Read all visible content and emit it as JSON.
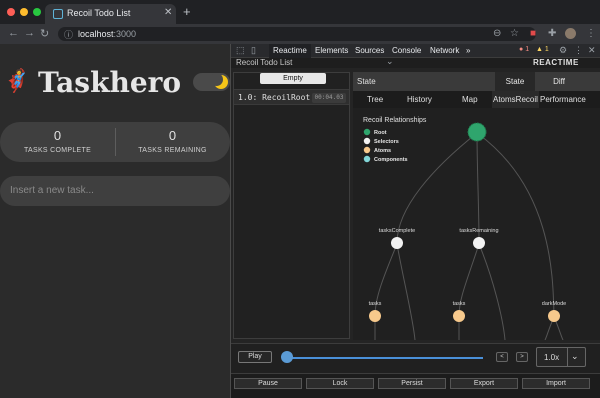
{
  "browser": {
    "tab_title": "Recoil Todo List",
    "tab_close": "✕",
    "new_tab": "+",
    "url_host": "localhost",
    "url_port": ":3000"
  },
  "app": {
    "title": "Taskhero",
    "dark_mode_on": true,
    "stats": [
      {
        "value": "0",
        "label": "TASKS COMPLETE"
      },
      {
        "value": "0",
        "label": "TASKS REMAINING"
      }
    ],
    "new_task_placeholder": "Insert a new task..."
  },
  "devtools": {
    "tabs": [
      "Reactime",
      "Elements",
      "Sources",
      "Console",
      "Network"
    ],
    "more_tabs": "»",
    "active_tab": "Reactime",
    "errors": "1",
    "warnings": "1",
    "page_label": "Recoil Todo List",
    "brand": "REACTIME",
    "empty_button": "Empty",
    "snapshot": {
      "label": "1.0: RecoilRoot",
      "time": "00:04.03"
    },
    "state_label": "State",
    "state_buttons": [
      "State",
      "Diff"
    ],
    "state_tabs": [
      "Tree",
      "History",
      "Map",
      "AtomsRecoil",
      "Performance"
    ],
    "active_state_tab": "AtomsRecoil",
    "graph": {
      "title": "Recoil Relationships",
      "legend": [
        {
          "label": "Root",
          "color": "#2fa56d"
        },
        {
          "label": "Selectors",
          "color": "#f2f2f2"
        },
        {
          "label": "Atoms",
          "color": "#f7c98c"
        },
        {
          "label": "Components",
          "color": "#82d6d8"
        }
      ],
      "selectors": [
        "tasksComplete",
        "tasksRemaining"
      ],
      "atoms": [
        "tasks",
        "tasks",
        "darkMode"
      ]
    },
    "timeline": {
      "play": "Play",
      "prev": "<",
      "next": ">",
      "speed": "1.0x",
      "progress": 0
    },
    "actions": [
      "Pause",
      "Lock",
      "Persist",
      "Export",
      "Import"
    ]
  }
}
